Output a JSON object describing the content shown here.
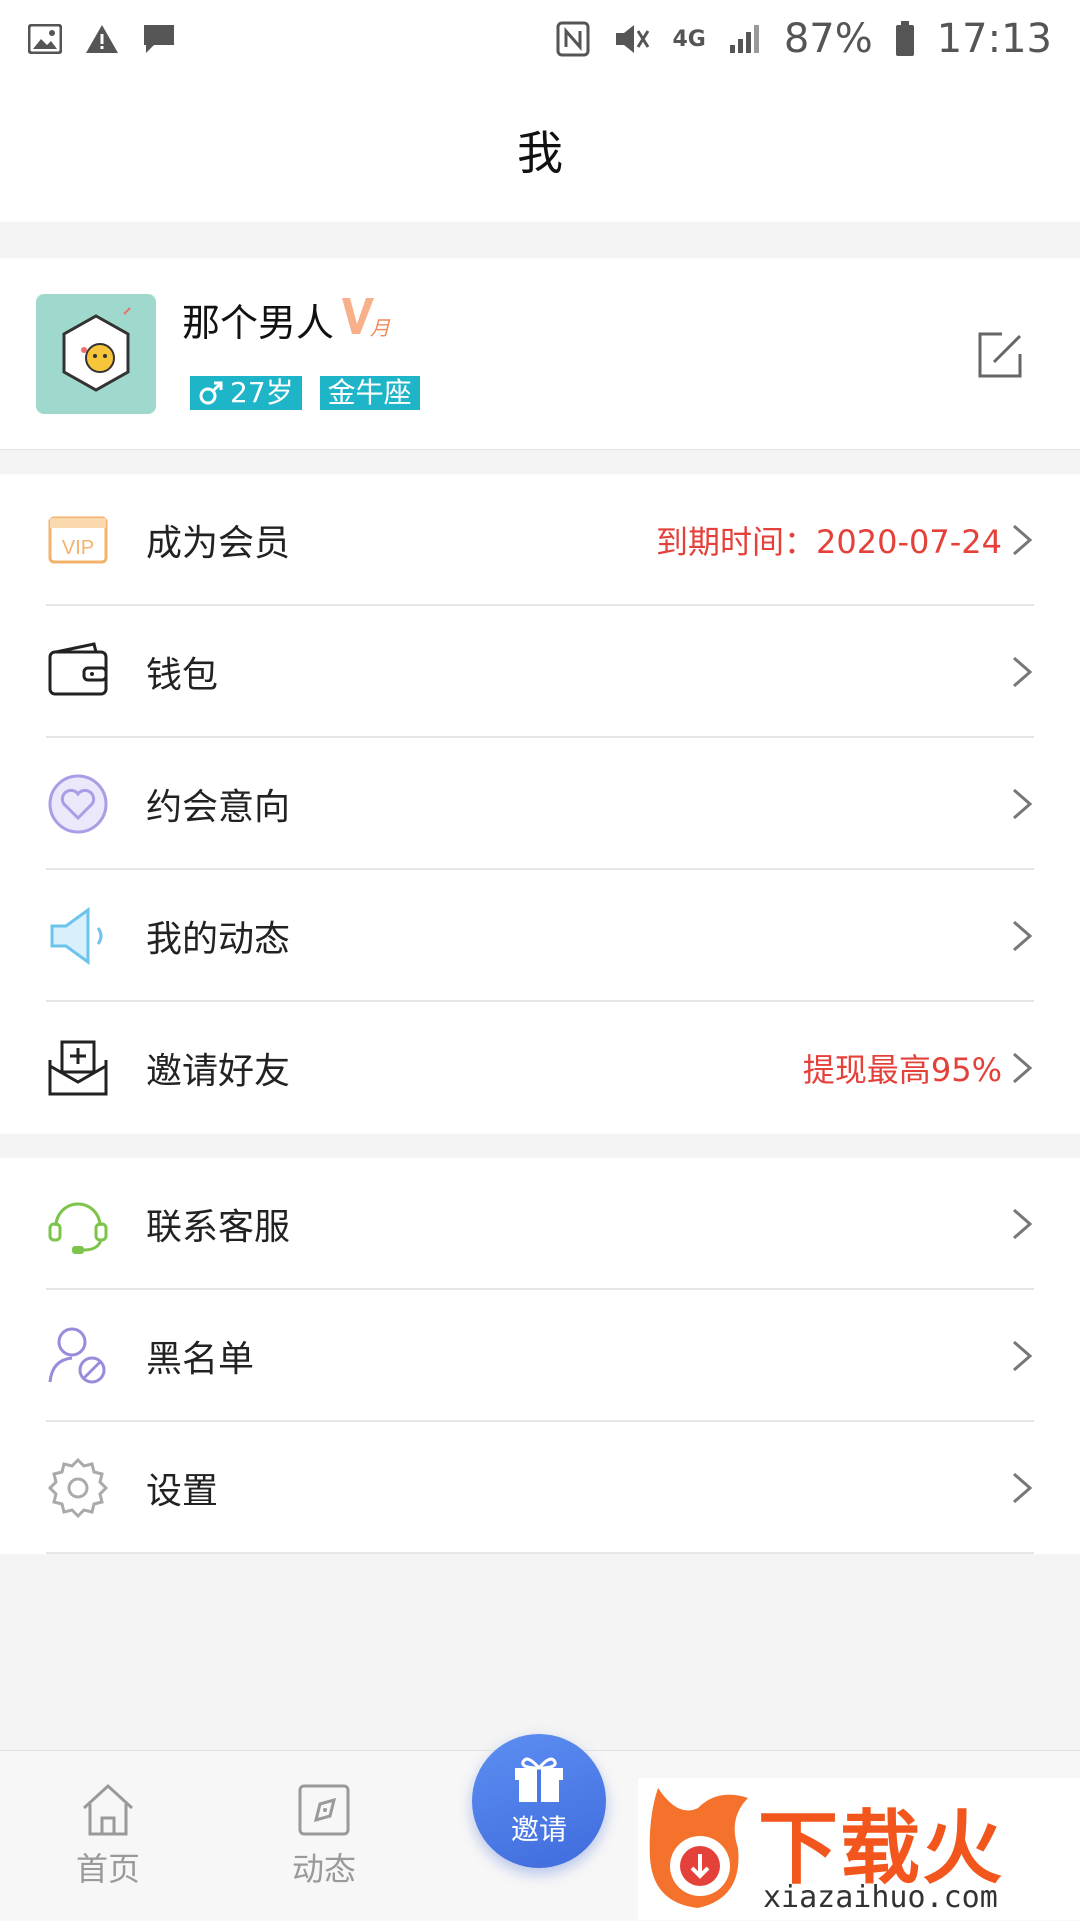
{
  "status_bar": {
    "battery": "87%",
    "time": "17:13",
    "network": "4G"
  },
  "header": {
    "title": "我"
  },
  "profile": {
    "name": "那个男人",
    "vip_badge": "月",
    "age": "27岁",
    "zodiac": "金牛座"
  },
  "menu_group1": [
    {
      "label": "成为会员",
      "value": "到期时间：2020-07-24",
      "icon": "vip-icon"
    },
    {
      "label": "钱包",
      "value": "",
      "icon": "wallet-icon"
    },
    {
      "label": "约会意向",
      "value": "",
      "icon": "heart-icon"
    },
    {
      "label": "我的动态",
      "value": "",
      "icon": "speaker-icon"
    },
    {
      "label": "邀请好友",
      "value": "提现最高95%",
      "icon": "invite-icon"
    }
  ],
  "menu_group2": [
    {
      "label": "联系客服",
      "icon": "headset-icon"
    },
    {
      "label": "黑名单",
      "icon": "blacklist-icon"
    },
    {
      "label": "设置",
      "icon": "gear-icon"
    }
  ],
  "tabbar": {
    "home": "首页",
    "feed": "动态",
    "invite": "邀请"
  },
  "watermark": {
    "brand": "下载火",
    "url": "xiazaihuo.com"
  },
  "colors": {
    "accent_red": "#e5413b",
    "tag_teal": "#1fb5c8",
    "fab_blue": "#4a78e6"
  }
}
